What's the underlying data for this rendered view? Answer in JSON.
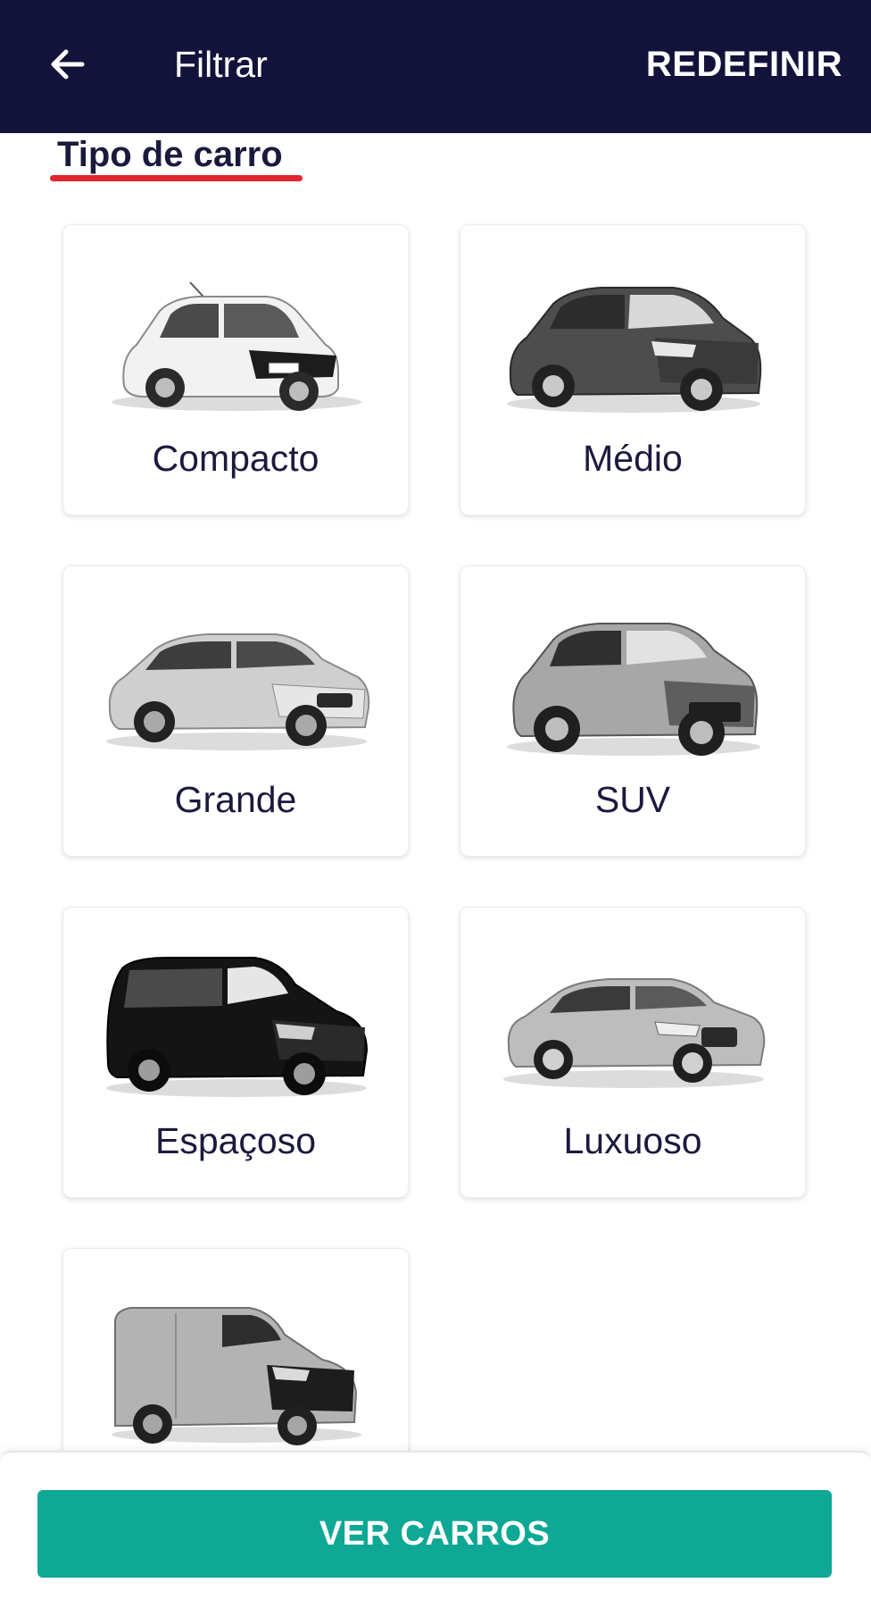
{
  "header": {
    "back_icon": "arrow-left-icon",
    "title": "Filtrar",
    "reset_label": "REDEFINIR",
    "background": "#13123a"
  },
  "section": {
    "title": "Tipo de carro",
    "underline_color": "#e0262e"
  },
  "car_types": [
    {
      "label": "Compacto",
      "image": "compact-car-image"
    },
    {
      "label": "Médio",
      "image": "medium-car-image"
    },
    {
      "label": "Grande",
      "image": "large-car-image"
    },
    {
      "label": "SUV",
      "image": "suv-car-image"
    },
    {
      "label": "Espaçoso",
      "image": "minivan-car-image"
    },
    {
      "label": "Luxuoso",
      "image": "luxury-car-image"
    },
    {
      "label": "",
      "image": "van-car-image"
    }
  ],
  "footer": {
    "cta_label": "VER CARROS",
    "cta_color": "#0ea894"
  }
}
